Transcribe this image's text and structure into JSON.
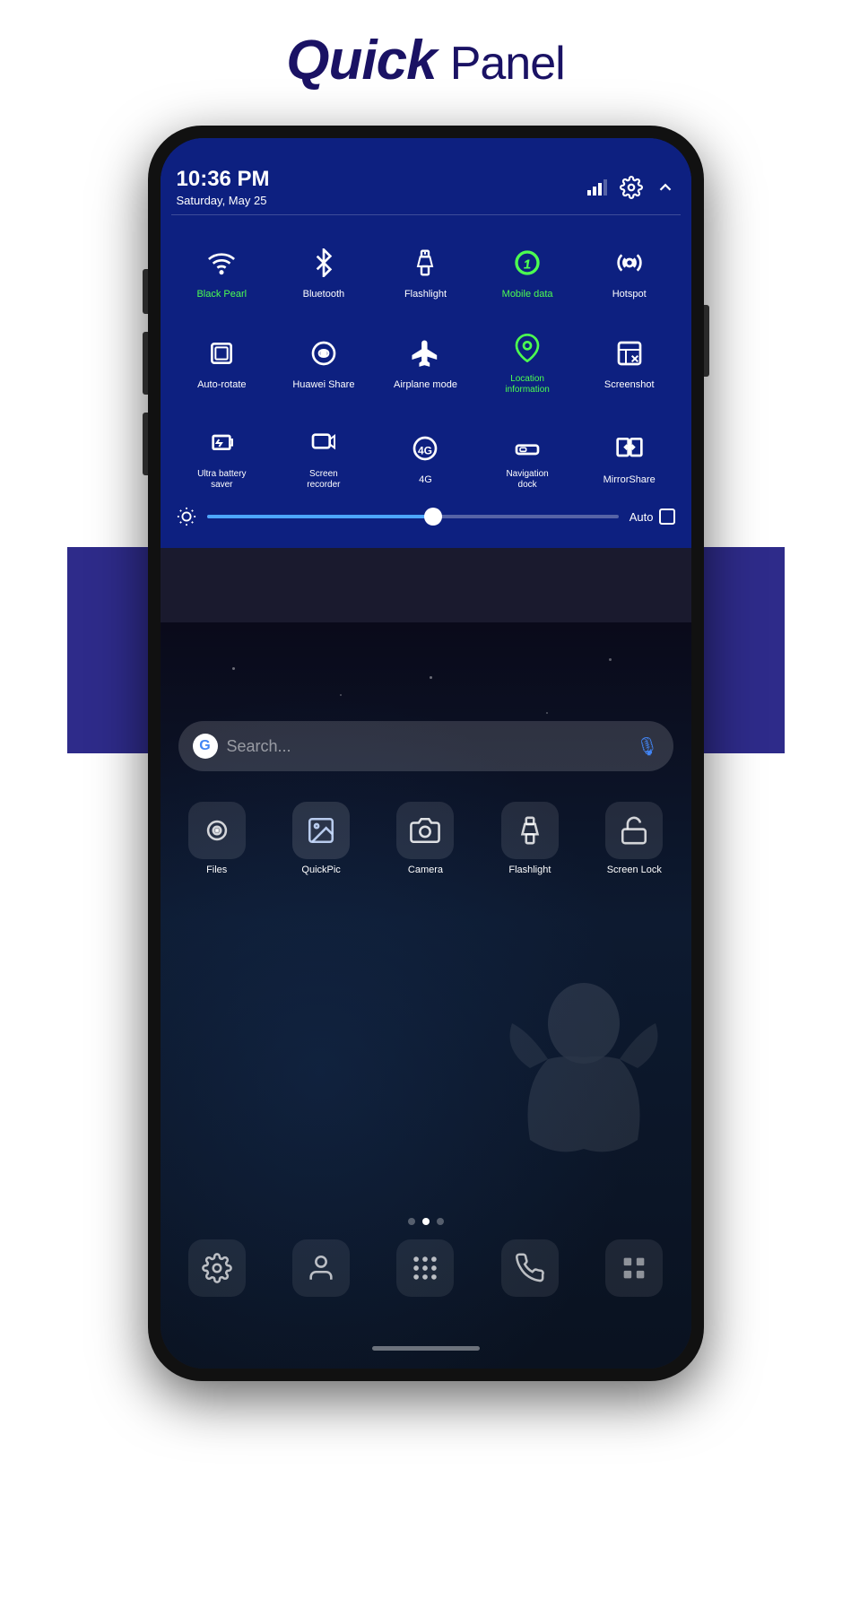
{
  "header": {
    "title_bold": "Quick",
    "title_normal": "Panel"
  },
  "statusBar": {
    "time": "10:36 PM",
    "date": "Saturday, May 25"
  },
  "quickPanel": {
    "row1": [
      {
        "id": "wifi",
        "label": "Black Pearl",
        "labelClass": "green",
        "iconType": "wifi",
        "active": true
      },
      {
        "id": "bluetooth",
        "label": "Bluetooth",
        "labelClass": "",
        "iconType": "bluetooth",
        "active": false
      },
      {
        "id": "flashlight",
        "label": "Flashlight",
        "labelClass": "",
        "iconType": "flashlight",
        "active": false
      },
      {
        "id": "mobiledata",
        "label": "Mobile data",
        "labelClass": "green",
        "iconType": "mobiledata",
        "active": true
      },
      {
        "id": "hotspot",
        "label": "Hotspot",
        "labelClass": "",
        "iconType": "hotspot",
        "active": false
      }
    ],
    "row2": [
      {
        "id": "autorotate",
        "label": "Auto-rotate",
        "labelClass": "",
        "iconType": "autorotate",
        "active": false
      },
      {
        "id": "huaweishare",
        "label": "Huawei Share",
        "labelClass": "",
        "iconType": "huaweishare",
        "active": false
      },
      {
        "id": "airplanemode",
        "label": "Airplane mode",
        "labelClass": "",
        "iconType": "airplane",
        "active": false
      },
      {
        "id": "location",
        "label": "Location information",
        "labelClass": "green",
        "iconType": "location",
        "active": true
      },
      {
        "id": "screenshot",
        "label": "Screenshot",
        "labelClass": "",
        "iconType": "screenshot",
        "active": false
      }
    ],
    "row3": [
      {
        "id": "ultrabattery",
        "label": "Ultra battery saver",
        "labelClass": "",
        "iconType": "battery",
        "active": false
      },
      {
        "id": "screenrecorder",
        "label": "Screen recorder",
        "labelClass": "",
        "iconType": "screenrecorder",
        "active": false
      },
      {
        "id": "4g",
        "label": "4G",
        "labelClass": "",
        "iconType": "4g",
        "active": false
      },
      {
        "id": "navdock",
        "label": "Navigation dock",
        "labelClass": "",
        "iconType": "navdock",
        "active": false
      },
      {
        "id": "mirrorshare",
        "label": "MirrorShare",
        "labelClass": "",
        "iconType": "mirrorshare",
        "active": false
      }
    ],
    "brightness": {
      "label": "Auto",
      "value": 55
    }
  },
  "homeScreen": {
    "searchPlaceholder": "Search...",
    "apps": [
      {
        "id": "files",
        "label": "Files",
        "icon": "📁"
      },
      {
        "id": "quickpic",
        "label": "QuickPic",
        "icon": "🖼️"
      },
      {
        "id": "camera",
        "label": "Camera",
        "icon": "📷"
      },
      {
        "id": "flashlight",
        "label": "Flashlight",
        "icon": "🔦"
      },
      {
        "id": "screenlock",
        "label": "Screen Lock",
        "icon": "🔓"
      }
    ],
    "dock": [
      {
        "id": "settings",
        "label": "",
        "icon": "⚙️"
      },
      {
        "id": "contacts",
        "label": "",
        "icon": "👤"
      },
      {
        "id": "apps",
        "label": "",
        "icon": "⋯"
      },
      {
        "id": "phone",
        "label": "",
        "icon": "📞"
      },
      {
        "id": "more",
        "label": "",
        "icon": "▪️"
      }
    ]
  }
}
